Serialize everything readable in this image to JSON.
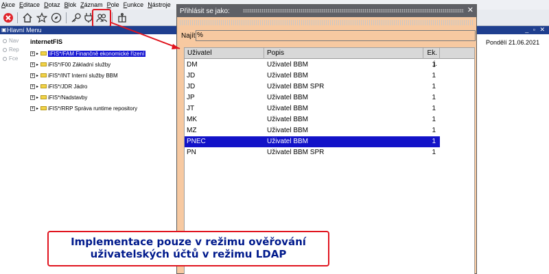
{
  "menubar": {
    "items": [
      "Akce",
      "Editace",
      "Dotaz",
      "Blok",
      "Záznam",
      "Pole",
      "Funkce",
      "Nástroje"
    ]
  },
  "toolbar": {
    "icons": [
      "close-icon",
      "home-icon",
      "star-icon",
      "compass-icon",
      "key-icon",
      "plug-icon",
      "users-icon",
      "package-icon"
    ],
    "highlight_color": "#e0141e"
  },
  "main_window": {
    "title": "Hlavní Menu"
  },
  "side_radios": [
    "Nav",
    "Rep",
    "Fce"
  ],
  "content": {
    "title": "internetFIS",
    "tree": [
      "iFIS*/FAM Finančně ekonomické řízení",
      "iFIS*/F00 Základní služby",
      "iFIS*/INT Interní služby BBM",
      "iFIS*/JDR Jádro",
      "iFIS*/Nadstavby",
      "iFIS*/RRP Správa runtime repository"
    ],
    "date": "Pondělí 21.06.2021"
  },
  "dialog": {
    "title": "Přihlásit se jako:",
    "close": "✕",
    "search_label": "Najít",
    "search_value": "%",
    "columns": [
      "Uživatel",
      "Popis",
      "Ek. j."
    ],
    "rows": [
      {
        "user": "DM",
        "desc": "Uživatel BBM",
        "ek": "1"
      },
      {
        "user": "JD",
        "desc": "Uživatel BBM",
        "ek": "1"
      },
      {
        "user": "JD",
        "desc": "Uživatel BBM SPR",
        "ek": "1"
      },
      {
        "user": "JP",
        "desc": "Uživatel BBM",
        "ek": "1"
      },
      {
        "user": "JT",
        "desc": "Uživatel BBM",
        "ek": "1"
      },
      {
        "user": "MK",
        "desc": "Uživatel BBM",
        "ek": "1"
      },
      {
        "user": "MZ",
        "desc": "Uživatel BBM",
        "ek": "1"
      },
      {
        "user": "PNEC",
        "desc": "Uživatel BBM",
        "ek": "1"
      },
      {
        "user": "PN",
        "desc": "Uživatel BBM SPR",
        "ek": "1"
      }
    ],
    "selected_row": 7,
    "selection_color": "#1212c8"
  },
  "annotation": {
    "line1": "Implementace pouze v režimu ověřování",
    "line2": "uživatelských účtů v režimu LDAP",
    "border_color": "#e0141e",
    "text_color": "#001a8c"
  }
}
